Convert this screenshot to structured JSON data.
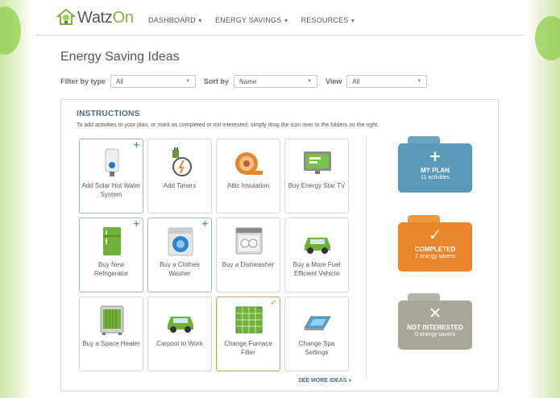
{
  "header": {
    "logo_text_a": "Watz",
    "logo_text_b": "On",
    "nav": [
      {
        "label": "DASHBOARD"
      },
      {
        "label": "ENERGY SAVINGS"
      },
      {
        "label": "RESOURCES"
      }
    ]
  },
  "page_title": "Energy Saving Ideas",
  "filters": [
    {
      "label": "Filter by type",
      "value": "All"
    },
    {
      "label": "Sort by",
      "value": "Name"
    },
    {
      "label": "View",
      "value": "All"
    }
  ],
  "instructions": {
    "title": "INSTRUCTIONS",
    "text": "To add activities to your plan, or mark as completed or not interested, simply drag the icon over to the folders on the right."
  },
  "tiles": [
    {
      "label": "Add Solar Hot Water System",
      "icon": "solar-water-heater-icon",
      "state": "added"
    },
    {
      "label": "Add Timers",
      "icon": "timer-plug-icon",
      "state": "none"
    },
    {
      "label": "Attic Insulation",
      "icon": "insulation-roll-icon",
      "state": "none"
    },
    {
      "label": "Buy Energy Star TV",
      "icon": "tv-icon",
      "state": "none"
    },
    {
      "label": "Buy New Refrigerator",
      "icon": "refrigerator-icon",
      "state": "added"
    },
    {
      "label": "Buy a Clothes Washer",
      "icon": "washer-icon",
      "state": "added"
    },
    {
      "label": "Buy a Dishwasher",
      "icon": "dishwasher-icon",
      "state": "none"
    },
    {
      "label": "Buy a More Fuel Efficient Vehicle",
      "icon": "car-icon",
      "state": "none"
    },
    {
      "label": "Buy a Space Heater",
      "icon": "space-heater-icon",
      "state": "none"
    },
    {
      "label": "Carpool to Work",
      "icon": "car-icon",
      "state": "none"
    },
    {
      "label": "Change Furnace Filter",
      "icon": "furnace-filter-icon",
      "state": "done"
    },
    {
      "label": "Change Spa Settings",
      "icon": "spa-icon",
      "state": "none"
    }
  ],
  "folders": [
    {
      "title": "MY PLAN",
      "sub": "11 activities",
      "symbol": "+",
      "color": "#5b99b8",
      "tab_color": "#6aa6c3"
    },
    {
      "title": "COMPLETED",
      "sub": "2 energy savers",
      "symbol": "✓",
      "color": "#e9852b",
      "tab_color": "#ef9842"
    },
    {
      "title": "NOT INTERESTED",
      "sub": "0 energy savers",
      "symbol": "✕",
      "color": "#a9a79a",
      "tab_color": "#b6b4a8"
    }
  ],
  "see_more": "SEE MORE IDEAS »",
  "marks": {
    "added": "+",
    "done": "✓"
  },
  "colors": {
    "accent_green": "#7db53a",
    "heading_blue": "#4a6a80"
  }
}
